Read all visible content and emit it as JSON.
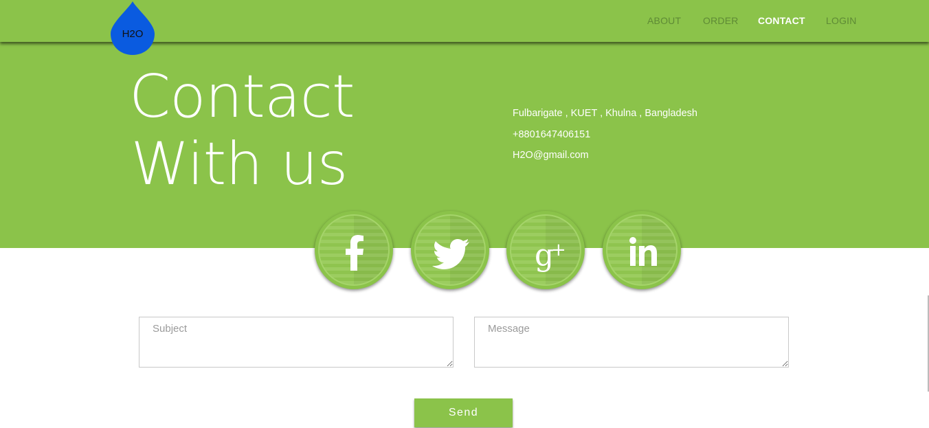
{
  "nav": {
    "logo_text": "H2O",
    "items": [
      {
        "label": "ABOUT",
        "active": false
      },
      {
        "label": "ORDER",
        "active": false
      },
      {
        "label": "CONTACT",
        "active": true
      },
      {
        "label": "LOGIN",
        "active": false
      }
    ]
  },
  "hero": {
    "title_line1": "Contact",
    "title_line2": "With us"
  },
  "contact": {
    "address": "Fulbarigate , KUET , Khulna , Bangladesh",
    "phone": "+8801647406151",
    "email": "H2O@gmail.com"
  },
  "social": [
    {
      "icon": "facebook-icon"
    },
    {
      "icon": "twitter-icon"
    },
    {
      "icon": "google-plus-icon"
    },
    {
      "icon": "linkedin-icon"
    }
  ],
  "form": {
    "subject_placeholder": "Subject",
    "message_placeholder": "Message",
    "send_label": "Send"
  },
  "colors": {
    "brand_green": "#8bc34a",
    "drop_blue": "#0a5be0",
    "text_white": "#ffffff"
  }
}
